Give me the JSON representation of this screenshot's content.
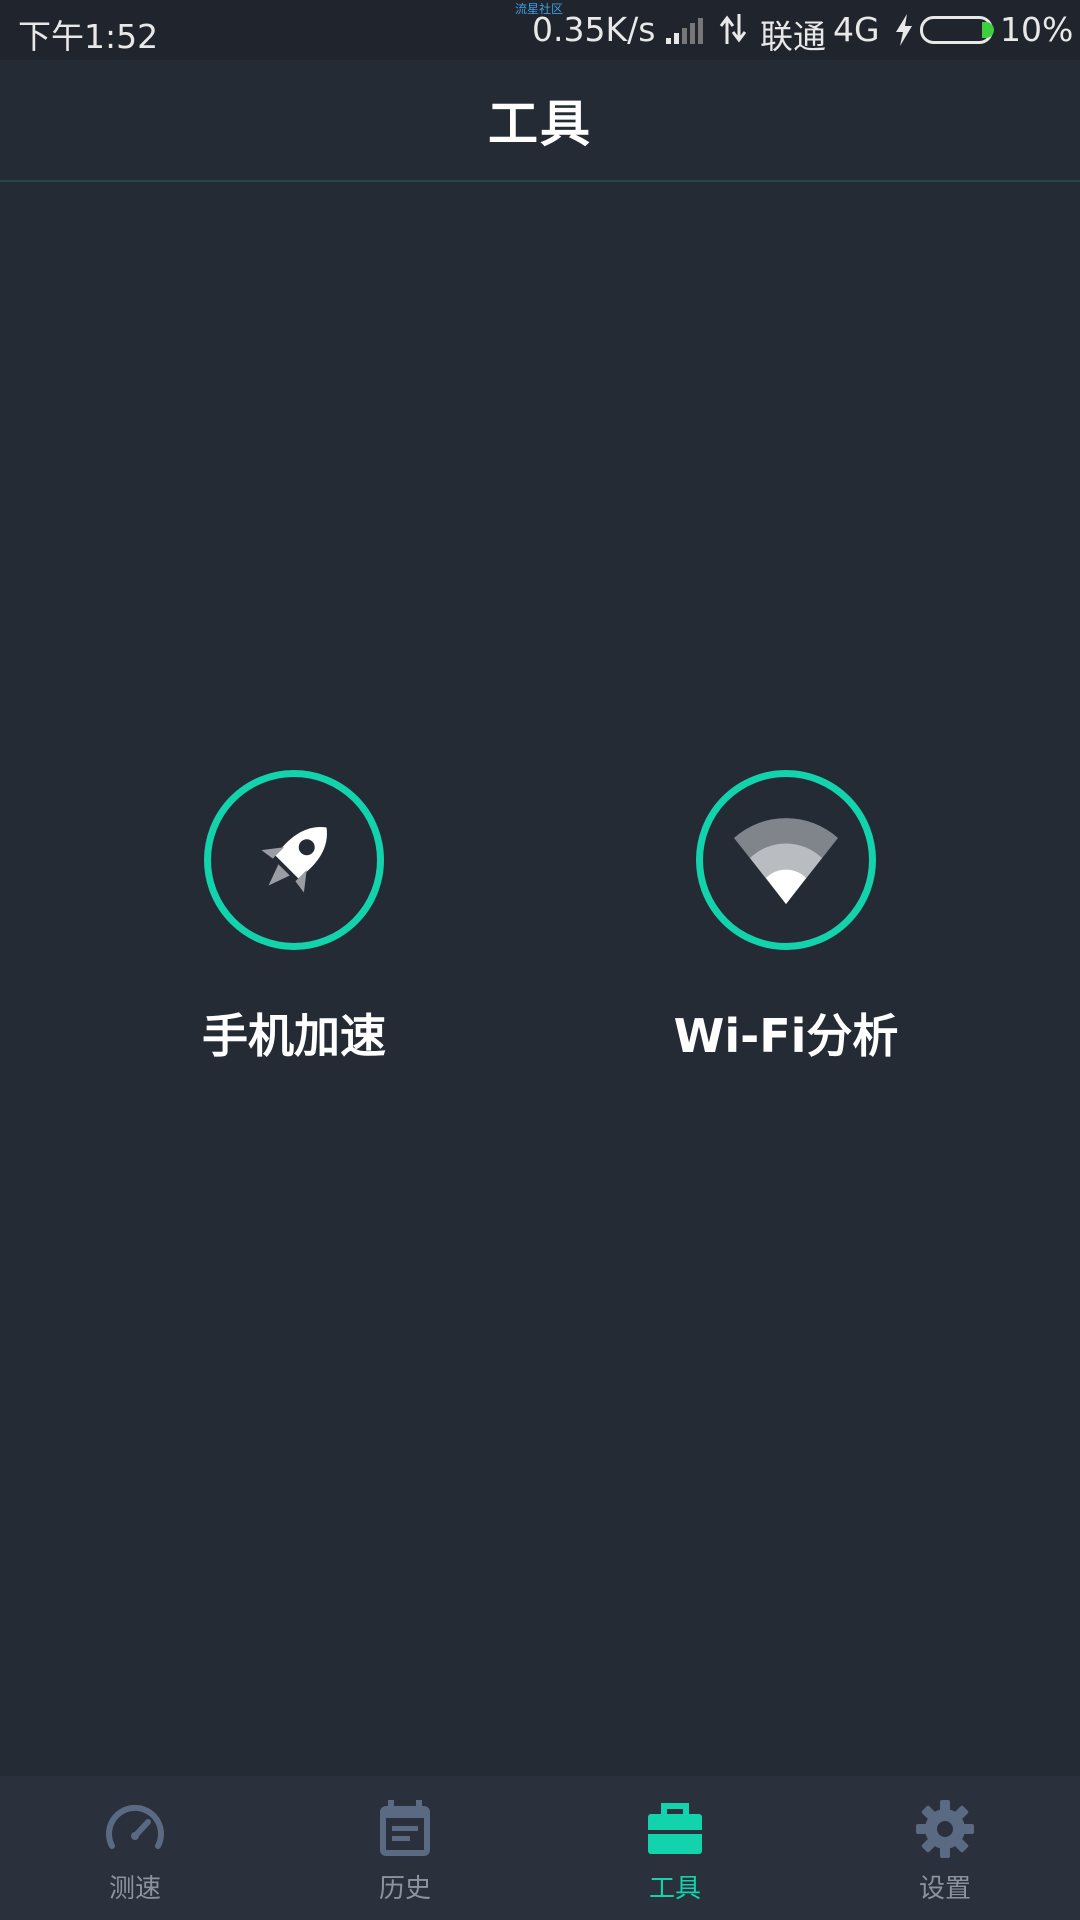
{
  "status_bar": {
    "time": "下午1:52",
    "top_note": "流星社区",
    "speed": "0.35K/s",
    "carrier": "联通",
    "network": "4G",
    "battery": "10%",
    "battery_level": 0.1
  },
  "header": {
    "title": "工具"
  },
  "tools": [
    {
      "label": "手机加速",
      "icon": "rocket-icon"
    },
    {
      "label": "Wi-Fi分析",
      "icon": "wifi-icon"
    }
  ],
  "bottom_nav": {
    "active": "工具",
    "items": [
      {
        "label": "测速",
        "icon": "speedometer-icon"
      },
      {
        "label": "历史",
        "icon": "calendar-icon"
      },
      {
        "label": "工具",
        "icon": "toolbox-icon"
      },
      {
        "label": "设置",
        "icon": "gear-icon"
      }
    ]
  },
  "colors": {
    "accent": "#13d3ac",
    "background": "#252b35",
    "nav_background": "#2a313d",
    "inactive": "#8c939e"
  }
}
